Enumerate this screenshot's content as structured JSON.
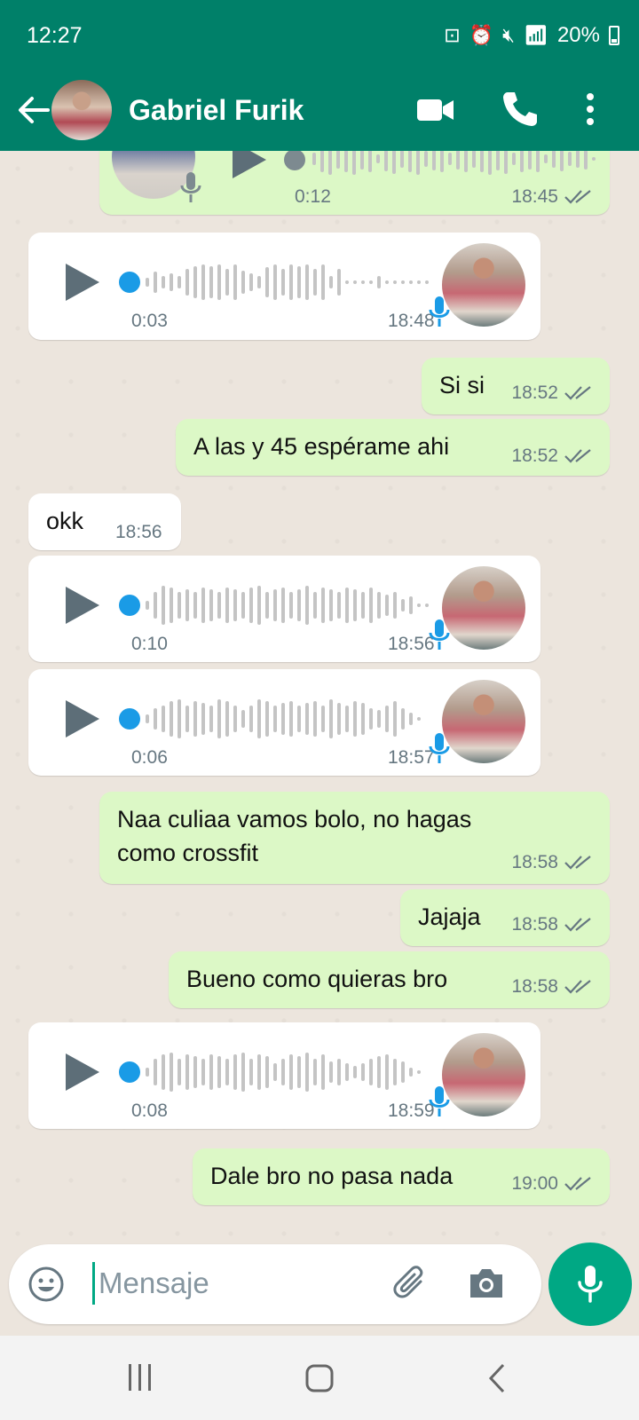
{
  "status_bar": {
    "time": "12:27",
    "battery": "20%"
  },
  "header": {
    "contact_name": "Gabriel Furik"
  },
  "messages": [
    {
      "type": "voice",
      "direction": "out",
      "duration": "0:12",
      "time": "18:45"
    },
    {
      "type": "voice",
      "direction": "in",
      "duration": "0:03",
      "time": "18:48"
    },
    {
      "type": "text",
      "direction": "out",
      "text": "Si si",
      "time": "18:52"
    },
    {
      "type": "text",
      "direction": "out",
      "text": "A las y 45 espérame ahi",
      "time": "18:52"
    },
    {
      "type": "text",
      "direction": "in",
      "text": "okk",
      "time": "18:56"
    },
    {
      "type": "voice",
      "direction": "in",
      "duration": "0:10",
      "time": "18:56"
    },
    {
      "type": "voice",
      "direction": "in",
      "duration": "0:06",
      "time": "18:57"
    },
    {
      "type": "text",
      "direction": "out",
      "text_lines": [
        "Naa culiaa vamos bolo, no hagas",
        "como crossfit"
      ],
      "time": "18:58"
    },
    {
      "type": "text",
      "direction": "out",
      "text": "Jajaja",
      "time": "18:58"
    },
    {
      "type": "text",
      "direction": "out",
      "text": "Bueno como quieras bro",
      "time": "18:58"
    },
    {
      "type": "voice",
      "direction": "in",
      "duration": "0:08",
      "time": "18:59"
    },
    {
      "type": "text",
      "direction": "out",
      "text": "Dale bro no pasa nada",
      "time": "19:00"
    }
  ],
  "composer": {
    "placeholder": "Mensaje"
  },
  "icons": {
    "back": "back-arrow-icon",
    "video": "video-call-icon",
    "call": "phone-icon",
    "menu": "more-vert-icon",
    "emoji": "emoji-icon",
    "attach": "paperclip-icon",
    "camera": "camera-icon",
    "mic": "mic-icon"
  },
  "colors": {
    "header": "#008069",
    "outgoing_bubble": "#dcf8c6",
    "incoming_bubble": "#ffffff",
    "accent": "#00a884",
    "voice_dot": "#1a9be6"
  }
}
